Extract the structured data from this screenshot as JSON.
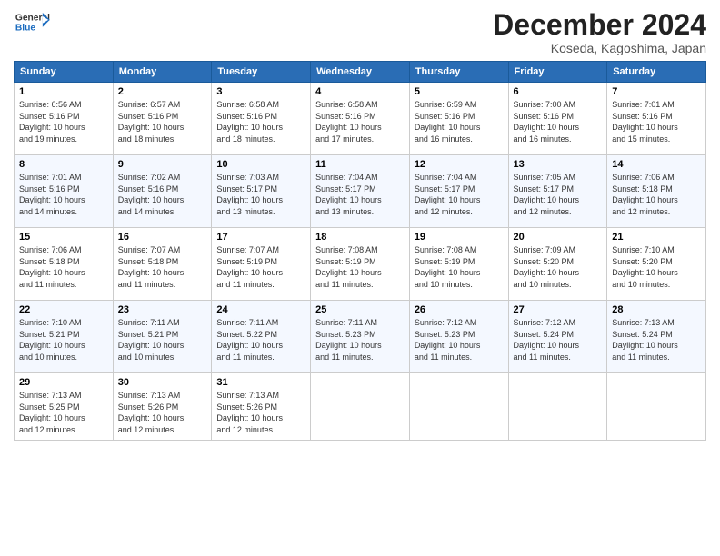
{
  "header": {
    "logo_general": "General",
    "logo_blue": "Blue",
    "month_title": "December 2024",
    "location": "Koseda, Kagoshima, Japan"
  },
  "weekdays": [
    "Sunday",
    "Monday",
    "Tuesday",
    "Wednesday",
    "Thursday",
    "Friday",
    "Saturday"
  ],
  "weeks": [
    [
      {
        "day": "1",
        "info": "Sunrise: 6:56 AM\nSunset: 5:16 PM\nDaylight: 10 hours\nand 19 minutes."
      },
      {
        "day": "2",
        "info": "Sunrise: 6:57 AM\nSunset: 5:16 PM\nDaylight: 10 hours\nand 18 minutes."
      },
      {
        "day": "3",
        "info": "Sunrise: 6:58 AM\nSunset: 5:16 PM\nDaylight: 10 hours\nand 18 minutes."
      },
      {
        "day": "4",
        "info": "Sunrise: 6:58 AM\nSunset: 5:16 PM\nDaylight: 10 hours\nand 17 minutes."
      },
      {
        "day": "5",
        "info": "Sunrise: 6:59 AM\nSunset: 5:16 PM\nDaylight: 10 hours\nand 16 minutes."
      },
      {
        "day": "6",
        "info": "Sunrise: 7:00 AM\nSunset: 5:16 PM\nDaylight: 10 hours\nand 16 minutes."
      },
      {
        "day": "7",
        "info": "Sunrise: 7:01 AM\nSunset: 5:16 PM\nDaylight: 10 hours\nand 15 minutes."
      }
    ],
    [
      {
        "day": "8",
        "info": "Sunrise: 7:01 AM\nSunset: 5:16 PM\nDaylight: 10 hours\nand 14 minutes."
      },
      {
        "day": "9",
        "info": "Sunrise: 7:02 AM\nSunset: 5:16 PM\nDaylight: 10 hours\nand 14 minutes."
      },
      {
        "day": "10",
        "info": "Sunrise: 7:03 AM\nSunset: 5:17 PM\nDaylight: 10 hours\nand 13 minutes."
      },
      {
        "day": "11",
        "info": "Sunrise: 7:04 AM\nSunset: 5:17 PM\nDaylight: 10 hours\nand 13 minutes."
      },
      {
        "day": "12",
        "info": "Sunrise: 7:04 AM\nSunset: 5:17 PM\nDaylight: 10 hours\nand 12 minutes."
      },
      {
        "day": "13",
        "info": "Sunrise: 7:05 AM\nSunset: 5:17 PM\nDaylight: 10 hours\nand 12 minutes."
      },
      {
        "day": "14",
        "info": "Sunrise: 7:06 AM\nSunset: 5:18 PM\nDaylight: 10 hours\nand 12 minutes."
      }
    ],
    [
      {
        "day": "15",
        "info": "Sunrise: 7:06 AM\nSunset: 5:18 PM\nDaylight: 10 hours\nand 11 minutes."
      },
      {
        "day": "16",
        "info": "Sunrise: 7:07 AM\nSunset: 5:18 PM\nDaylight: 10 hours\nand 11 minutes."
      },
      {
        "day": "17",
        "info": "Sunrise: 7:07 AM\nSunset: 5:19 PM\nDaylight: 10 hours\nand 11 minutes."
      },
      {
        "day": "18",
        "info": "Sunrise: 7:08 AM\nSunset: 5:19 PM\nDaylight: 10 hours\nand 11 minutes."
      },
      {
        "day": "19",
        "info": "Sunrise: 7:08 AM\nSunset: 5:19 PM\nDaylight: 10 hours\nand 10 minutes."
      },
      {
        "day": "20",
        "info": "Sunrise: 7:09 AM\nSunset: 5:20 PM\nDaylight: 10 hours\nand 10 minutes."
      },
      {
        "day": "21",
        "info": "Sunrise: 7:10 AM\nSunset: 5:20 PM\nDaylight: 10 hours\nand 10 minutes."
      }
    ],
    [
      {
        "day": "22",
        "info": "Sunrise: 7:10 AM\nSunset: 5:21 PM\nDaylight: 10 hours\nand 10 minutes."
      },
      {
        "day": "23",
        "info": "Sunrise: 7:11 AM\nSunset: 5:21 PM\nDaylight: 10 hours\nand 10 minutes."
      },
      {
        "day": "24",
        "info": "Sunrise: 7:11 AM\nSunset: 5:22 PM\nDaylight: 10 hours\nand 11 minutes."
      },
      {
        "day": "25",
        "info": "Sunrise: 7:11 AM\nSunset: 5:23 PM\nDaylight: 10 hours\nand 11 minutes."
      },
      {
        "day": "26",
        "info": "Sunrise: 7:12 AM\nSunset: 5:23 PM\nDaylight: 10 hours\nand 11 minutes."
      },
      {
        "day": "27",
        "info": "Sunrise: 7:12 AM\nSunset: 5:24 PM\nDaylight: 10 hours\nand 11 minutes."
      },
      {
        "day": "28",
        "info": "Sunrise: 7:13 AM\nSunset: 5:24 PM\nDaylight: 10 hours\nand 11 minutes."
      }
    ],
    [
      {
        "day": "29",
        "info": "Sunrise: 7:13 AM\nSunset: 5:25 PM\nDaylight: 10 hours\nand 12 minutes."
      },
      {
        "day": "30",
        "info": "Sunrise: 7:13 AM\nSunset: 5:26 PM\nDaylight: 10 hours\nand 12 minutes."
      },
      {
        "day": "31",
        "info": "Sunrise: 7:13 AM\nSunset: 5:26 PM\nDaylight: 10 hours\nand 12 minutes."
      },
      {
        "day": "",
        "info": ""
      },
      {
        "day": "",
        "info": ""
      },
      {
        "day": "",
        "info": ""
      },
      {
        "day": "",
        "info": ""
      }
    ]
  ]
}
